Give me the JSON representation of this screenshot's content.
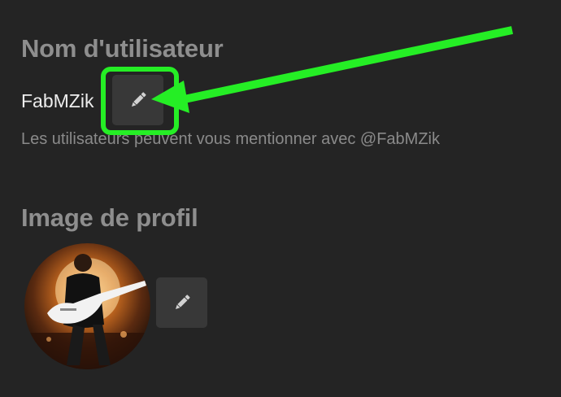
{
  "username_section": {
    "title": "Nom d'utilisateur",
    "value": "FabMZik",
    "helper": "Les utilisateurs peuvent vous mentionner avec @FabMZik",
    "edit_icon": "pencil-icon"
  },
  "avatar_section": {
    "title": "Image de profil",
    "edit_icon": "pencil-icon"
  },
  "annotation": {
    "highlight_color": "#25ee25",
    "arrow_color": "#25ee25"
  },
  "colors": {
    "background": "#242424",
    "button": "#383838",
    "title": "#8e8e8e",
    "text": "#ededed",
    "muted": "#8a8a8a"
  }
}
